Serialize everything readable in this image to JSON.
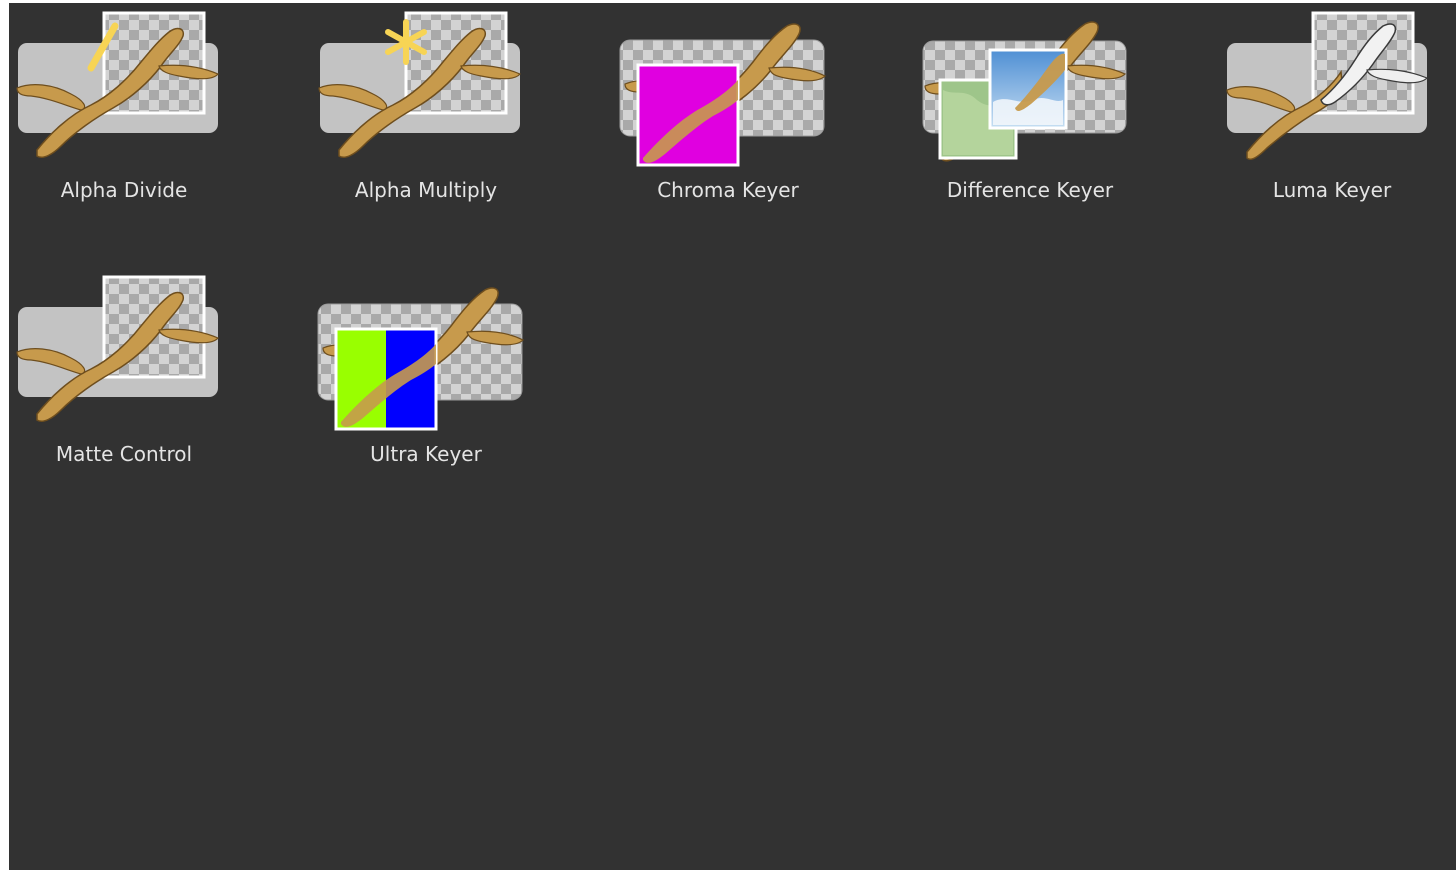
{
  "window": {
    "background": "#323232"
  },
  "tools": [
    {
      "label": "Alpha Divide",
      "icon": "alpha-divide-icon",
      "badge": "slash",
      "badge_color": "#f7d455"
    },
    {
      "label": "Alpha Multiply",
      "icon": "alpha-multiply-icon",
      "badge": "asterisk",
      "badge_color": "#f7d455"
    },
    {
      "label": "Chroma Keyer",
      "icon": "chroma-keyer-icon",
      "swatch_colors": [
        "#e000e0"
      ]
    },
    {
      "label": "Difference Keyer",
      "icon": "difference-keyer-icon",
      "swatch_colors": [
        "#9ec58a",
        "#8cbbe6"
      ]
    },
    {
      "label": "Luma Keyer",
      "icon": "luma-keyer-icon",
      "badge": "grayscale"
    },
    {
      "label": "Matte Control",
      "icon": "matte-control-icon"
    },
    {
      "label": "Ultra Keyer",
      "icon": "ultra-keyer-icon",
      "swatch_colors": [
        "#99ff00",
        "#0000ff"
      ]
    }
  ]
}
